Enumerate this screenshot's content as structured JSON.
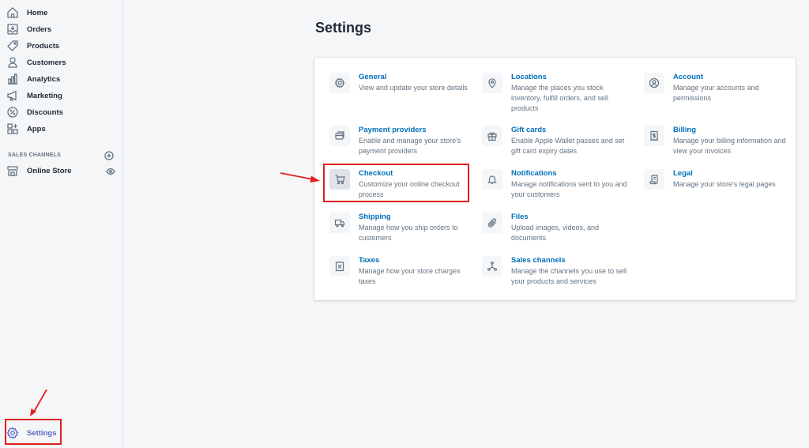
{
  "sidebar": {
    "nav": [
      {
        "label": "Home",
        "icon": "home-icon"
      },
      {
        "label": "Orders",
        "icon": "orders-icon"
      },
      {
        "label": "Products",
        "icon": "tag-icon"
      },
      {
        "label": "Customers",
        "icon": "person-icon"
      },
      {
        "label": "Analytics",
        "icon": "bar-chart-icon"
      },
      {
        "label": "Marketing",
        "icon": "megaphone-icon"
      },
      {
        "label": "Discounts",
        "icon": "discount-icon"
      },
      {
        "label": "Apps",
        "icon": "apps-icon"
      }
    ],
    "sales_channels_label": "SALES CHANNELS",
    "online_store_label": "Online Store",
    "settings_label": "Settings"
  },
  "page": {
    "title": "Settings"
  },
  "settings": [
    {
      "title": "General",
      "desc": "View and update your store details",
      "icon": "gear-icon"
    },
    {
      "title": "Locations",
      "desc": "Manage the places you stock inventory, fulfill orders, and sell products",
      "icon": "location-pin-icon"
    },
    {
      "title": "Account",
      "desc": "Manage your accounts and permissions",
      "icon": "account-icon"
    },
    {
      "title": "Payment providers",
      "desc": "Enable and manage your store's payment providers",
      "icon": "payment-icon"
    },
    {
      "title": "Gift cards",
      "desc": "Enable Apple Wallet passes and set gift card expiry dates",
      "icon": "gift-icon"
    },
    {
      "title": "Billing",
      "desc": "Manage your billing information and view your invoices",
      "icon": "billing-icon"
    },
    {
      "title": "Checkout",
      "desc": "Customize your online checkout process",
      "icon": "cart-icon"
    },
    {
      "title": "Notifications",
      "desc": "Manage notifications sent to you and your customers",
      "icon": "bell-icon"
    },
    {
      "title": "Legal",
      "desc": "Manage your store's legal pages",
      "icon": "legal-icon"
    },
    {
      "title": "Shipping",
      "desc": "Manage how you ship orders to customers",
      "icon": "truck-icon"
    },
    {
      "title": "Files",
      "desc": "Upload images, videos, and documents",
      "icon": "paperclip-icon"
    },
    {
      "title": "Taxes",
      "desc": "Manage how your store charges taxes",
      "icon": "tax-icon"
    },
    {
      "title": "Sales channels",
      "desc": "Manage the channels you use to sell your products and services",
      "icon": "channels-icon"
    }
  ],
  "colors": {
    "link": "#006fbb",
    "accent": "#5c6ac4",
    "annotation": "#e0201e"
  }
}
